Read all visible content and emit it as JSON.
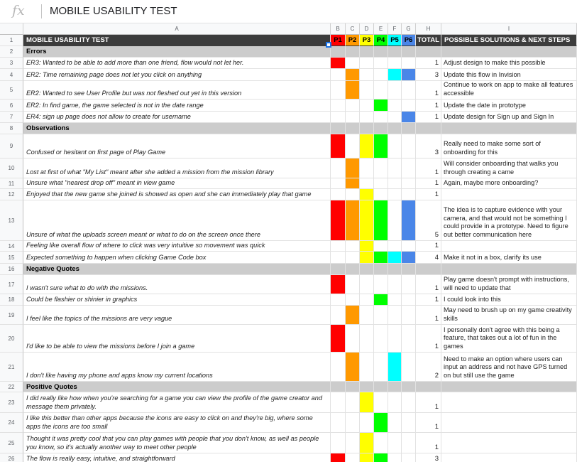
{
  "formula_bar": {
    "fx_label": "fx",
    "content": "MOBILE USABILITY TEST"
  },
  "column_letters": [
    "A",
    "B",
    "C",
    "D",
    "E",
    "F",
    "G",
    "H",
    "I"
  ],
  "colors": {
    "P1": "#ff0000",
    "P2": "#ff9900",
    "P3": "#ffff00",
    "P4": "#00ff00",
    "P5": "#00ffff",
    "P6": "#4a86e8",
    "header_bg": "#3c3c3c",
    "section_bg": "#cccccc"
  },
  "header": {
    "row_number": "1",
    "title": "MOBILE USABILITY TEST",
    "participants": [
      "P1",
      "P2",
      "P3",
      "P4",
      "P5",
      "P6"
    ],
    "total": "TOTAL",
    "solutions": "POSSIBLE SOLUTIONS & NEXT STEPS"
  },
  "rows": [
    {
      "n": "2",
      "type": "section",
      "text": "Errors"
    },
    {
      "n": "3",
      "text": "ER3: Wanted to be able to add more than one friend, flow would not let her.",
      "marks": [
        "P1"
      ],
      "total": "1",
      "solution": "Adjust design to make this possible"
    },
    {
      "n": "4",
      "text": "ER2: Time remaining page does not let you click on anything",
      "marks": [
        "P2",
        "P5",
        "P6"
      ],
      "total": "3",
      "solution": "Update this flow in Invision"
    },
    {
      "n": "5",
      "text": "ER2: Wanted to see User Profile but was not fleshed out yet in this version",
      "marks": [
        "P2"
      ],
      "total": "1",
      "solution": "Continue to work on app to make all features accessible"
    },
    {
      "n": "6",
      "text": "ER2: In find game, the game selected is not in the date range",
      "marks": [
        "P4"
      ],
      "total": "1",
      "solution": "Update the date in prototype"
    },
    {
      "n": "7",
      "text": "ER4: sign up page does not allow to create for username",
      "marks": [
        "P6"
      ],
      "total": "1",
      "solution": "Update design for Sign up and Sign In"
    },
    {
      "n": "8",
      "type": "section",
      "text": "Observations"
    },
    {
      "n": "9",
      "text": "Confused or hesitant on first page of Play Game",
      "marks": [
        "P1",
        "P3",
        "P4"
      ],
      "total": "3",
      "solution": "Really need to make some sort of onboarding for this"
    },
    {
      "n": "10",
      "text": "Lost at first of what \"My List\" meant after she added a mission from the mission library",
      "marks": [
        "P2"
      ],
      "total": "1",
      "solution": "Will consider onboarding that walks you through creating a came"
    },
    {
      "n": "11",
      "text": "Unsure what \"nearest drop off\" meant in view game",
      "marks": [
        "P2"
      ],
      "total": "1",
      "solution": "Again, maybe more onboarding?"
    },
    {
      "n": "12",
      "text": "Enjoyed that the new game she joined is showed as open and she can immediately play that game",
      "marks": [
        "P3"
      ],
      "total": "1",
      "solution": ""
    },
    {
      "n": "13",
      "text": "Unsure of what the uploads screen meant or what to do on the screen once there",
      "marks": [
        "P1",
        "P2",
        "P3",
        "P4",
        "P6"
      ],
      "total": "5",
      "solution": "The idea is to capture evidence with your camera, and that would not be something I could provide in a prototype. Need to figure out better communication here"
    },
    {
      "n": "14",
      "text": "Feeling like overall flow of where to click was very intuitive so movement was quick",
      "marks": [
        "P3"
      ],
      "total": "1",
      "solution": ""
    },
    {
      "n": "15",
      "text": "Expected something to happen when clicking Game Code box",
      "marks": [
        "P3",
        "P4",
        "P5",
        "P6"
      ],
      "total": "4",
      "solution": "Make it not in a box, clarify its use"
    },
    {
      "n": "16",
      "type": "section",
      "text": "Negative Quotes"
    },
    {
      "n": "17",
      "text": "I wasn't sure what to do with the missions.",
      "marks": [
        "P1"
      ],
      "total": "1",
      "solution": "Play game doesn't prompt with instructions, will need to update that"
    },
    {
      "n": "18",
      "text": "Could be flashier or shinier in graphics",
      "marks": [
        "P4"
      ],
      "total": "1",
      "solution": "I could look into this"
    },
    {
      "n": "19",
      "text": "I feel like the topics of the missions are very vague",
      "marks": [
        "P2"
      ],
      "total": "1",
      "solution": "May need to brush up on my game creativity skills"
    },
    {
      "n": "20",
      "text": "I'd like to be able to view the missions before I join a game",
      "marks": [
        "P1"
      ],
      "total": "1",
      "solution": "I personally don't agree with this being a feature, that takes out a lot of fun in the games"
    },
    {
      "n": "21",
      "text": "I don't like having my phone and apps know my current locations",
      "marks": [
        "P2",
        "P5"
      ],
      "total": "2",
      "solution": "Need to make an option where users can input an address and not have GPS turned on but still use the game"
    },
    {
      "n": "22",
      "type": "section",
      "text": "Positive Quotes"
    },
    {
      "n": "23",
      "text": "I did really like how when you're searching for a game you can view the profile of the game creator and message them privately.",
      "marks": [
        "P3"
      ],
      "total": "1",
      "solution": ""
    },
    {
      "n": "24",
      "text": "I like this better than other apps because the icons are easy to click on and they're big, where some apps the icons are too small",
      "marks": [
        "P4"
      ],
      "total": "1",
      "solution": ""
    },
    {
      "n": "25",
      "text": "Thought it was pretty cool that you can play games with people that you don't know, as well as people you know, so it's actually another way to meet other people",
      "marks": [
        "P3"
      ],
      "total": "1",
      "solution": ""
    },
    {
      "n": "26",
      "text": "The flow is really easy, intuitive, and straightforward",
      "marks": [
        "P1",
        "P3",
        "P4"
      ],
      "total": "3",
      "solution": ""
    }
  ]
}
